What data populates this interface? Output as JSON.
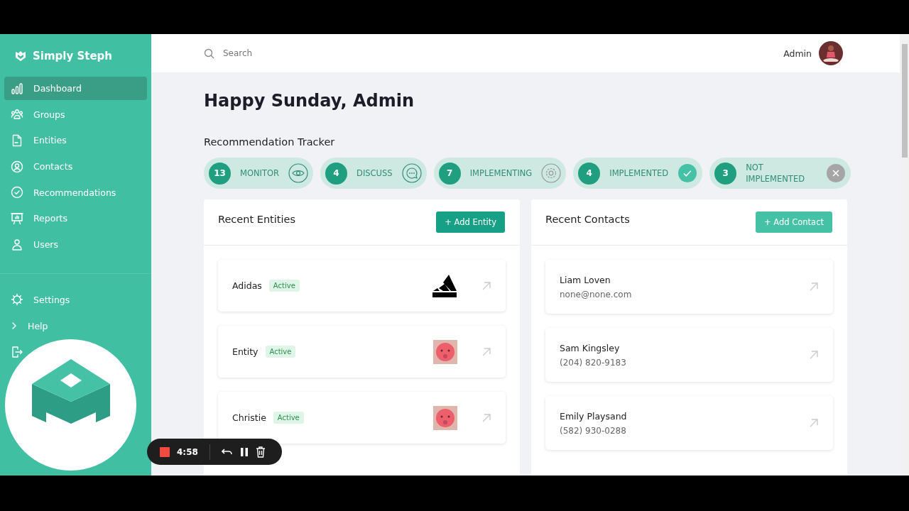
{
  "brand": {
    "name": "Simply Steph"
  },
  "sidebar": {
    "items": [
      {
        "label": "Dashboard",
        "selected": true
      },
      {
        "label": "Groups",
        "selected": false
      },
      {
        "label": "Entities",
        "selected": false
      },
      {
        "label": "Contacts",
        "selected": false
      },
      {
        "label": "Recommendations",
        "selected": false
      },
      {
        "label": "Reports",
        "selected": false
      },
      {
        "label": "Users",
        "selected": false
      }
    ],
    "bottom_items": [
      {
        "label": "Settings"
      },
      {
        "label": "Help"
      }
    ]
  },
  "header": {
    "search": {
      "placeholder": "Search"
    },
    "user": "Admin"
  },
  "greeting": "Happy Sunday, Admin",
  "tracker": {
    "title": "Recommendation Tracker",
    "stages": [
      {
        "count": "13",
        "label": "MONITOR",
        "kind": "eye"
      },
      {
        "count": "4",
        "label": "DISCUSS",
        "kind": "chat"
      },
      {
        "count": "7",
        "label": "IMPLEMENTING",
        "kind": "gear"
      },
      {
        "count": "4",
        "label": "IMPLEMENTED",
        "kind": "done"
      },
      {
        "count": "3",
        "label": "NOT IMPLEMENTED",
        "kind": "rejected"
      }
    ]
  },
  "recent_entities": {
    "title": "Recent Entities",
    "button": "+ Add Entity",
    "items": [
      {
        "name": "Adidas",
        "status": "Active",
        "kind": "logo"
      },
      {
        "name": "Entity",
        "status": "Active",
        "kind": "picture"
      },
      {
        "name": "Christie",
        "status": "Active",
        "kind": "picture"
      }
    ]
  },
  "recent_contacts": {
    "title": "Recent Contacts",
    "button": "+ Add Contact",
    "items": [
      {
        "name": "Liam Loven",
        "detail": "none@none.com"
      },
      {
        "name": "Sam Kingsley",
        "detail": "(204) 820-9183"
      },
      {
        "name": "Emily Playsand",
        "detail": "(582) 930-0288"
      }
    ]
  },
  "recorder": {
    "time": "4:58"
  }
}
